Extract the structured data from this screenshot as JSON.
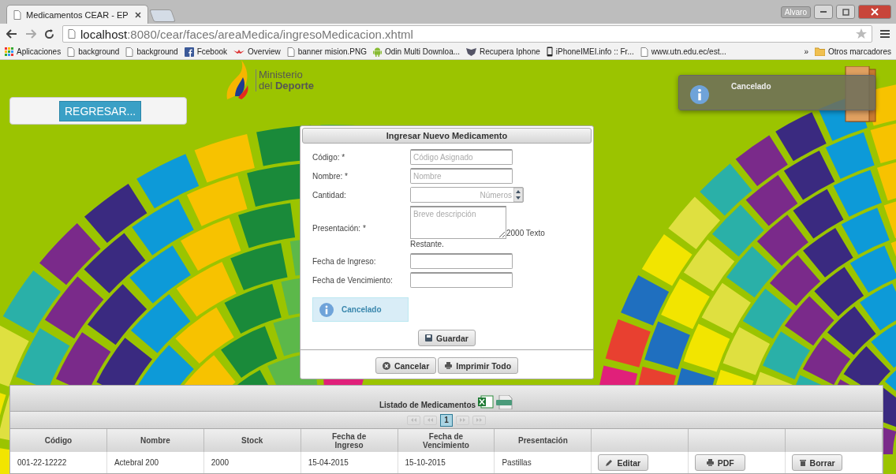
{
  "browser": {
    "tabs": [
      {
        "title": "Medicamentos CEAR - EP",
        "selected": true
      }
    ],
    "user": "Alvaro",
    "url": {
      "host": "localhost",
      "path": ":8080/cear/faces/areaMedica/ingresoMedicacion.xhtml"
    },
    "bookmarks": [
      {
        "label": "Aplicaciones",
        "kind": "apps"
      },
      {
        "label": "background",
        "kind": "page"
      },
      {
        "label": "background",
        "kind": "page"
      },
      {
        "label": "Fcebook",
        "kind": "facebook"
      },
      {
        "label": "Overview",
        "kind": "bird"
      },
      {
        "label": "banner mision.PNG",
        "kind": "page"
      },
      {
        "label": "Odin Multi Downloa...",
        "kind": "android"
      },
      {
        "label": "Recupera Iphone",
        "kind": "shield"
      },
      {
        "label": "iPhoneIMEI.info :: Fr...",
        "kind": "phone"
      },
      {
        "label": "www.utn.edu.ec/est...",
        "kind": "page"
      }
    ],
    "more": "»",
    "other_bookmarks": "Otros marcadores"
  },
  "back_button": "REGRESAR...",
  "logo": {
    "line1": "Ministerio",
    "line2": "del **Deporte**"
  },
  "notification": {
    "title": "Cancelado"
  },
  "form": {
    "title": "Ingresar Nuevo Medicamento",
    "fields": [
      {
        "label": "Código: *",
        "kind": "text",
        "placeholder": "Código Asignado"
      },
      {
        "label": "Nombre: *",
        "kind": "text",
        "placeholder": "Nombre"
      },
      {
        "label": "Cantidad:",
        "kind": "spinner",
        "placeholder": "Números"
      },
      {
        "label": "Presentación: *",
        "kind": "textarea",
        "placeholder": "Breve descripción",
        "counter": "2000 Texto Restante."
      },
      {
        "label": "Fecha de Ingreso:",
        "kind": "text"
      },
      {
        "label": "Fecha de Vencimiento:",
        "kind": "text"
      }
    ],
    "message": "Cancelado",
    "save_button": "Guardar",
    "footer_buttons": [
      {
        "label": "Cancelar",
        "kind": "cancel"
      },
      {
        "label": "Imprimir Todo",
        "kind": "print"
      }
    ]
  },
  "table": {
    "title": "Listado de Medicamentos",
    "pages": [
      {
        "label": "1",
        "selected": true
      }
    ],
    "columns": [
      "Código",
      "Nombre",
      "Stock",
      "Fecha de Ingreso",
      "Fecha de Vencimiento",
      "Presentación"
    ],
    "actions": [
      {
        "label": "Editar",
        "kind": "edit"
      },
      {
        "label": "PDF",
        "kind": "print"
      },
      {
        "label": "Borrar",
        "kind": "trash"
      }
    ],
    "rows": [
      [
        "001-22-12222",
        "Actebral 200",
        "2000",
        "15-04-2015",
        "15-10-2015",
        "Pastillas"
      ]
    ]
  }
}
